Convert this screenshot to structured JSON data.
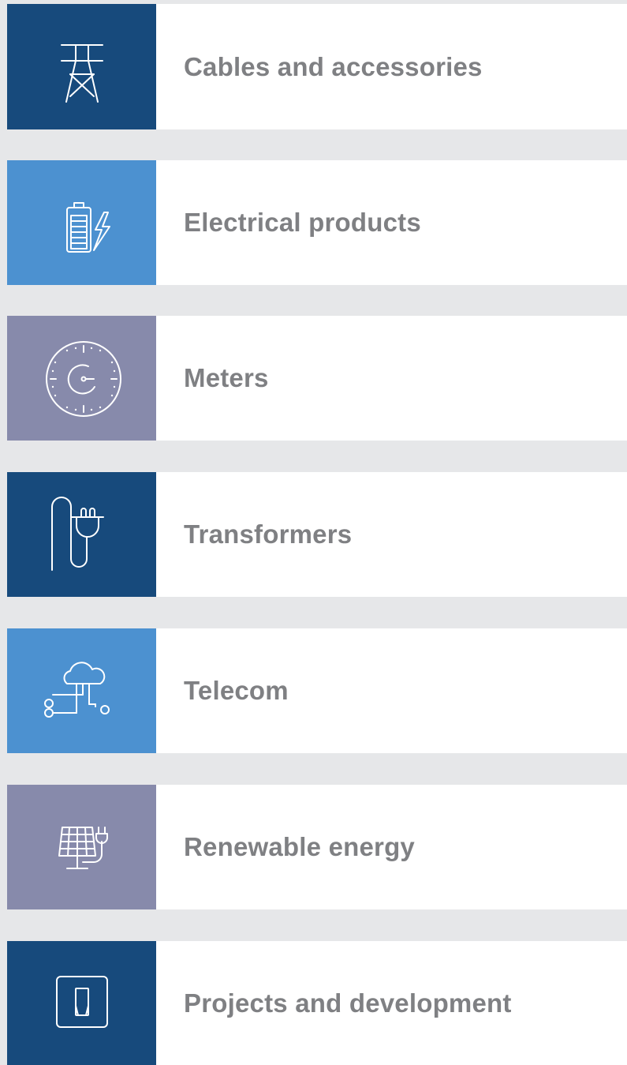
{
  "colors": {
    "page_background": "#e6e7e9",
    "card_background": "#ffffff",
    "label_text": "#7f8083",
    "tile_dark_blue": "#174a7c",
    "tile_light_blue": "#4c91d0",
    "tile_slate": "#878aab"
  },
  "categories": [
    {
      "label": "Cables and accessories",
      "icon": "transmission-tower-icon",
      "tile_color": "#174a7c"
    },
    {
      "label": "Electrical products",
      "icon": "battery-lightning-icon",
      "tile_color": "#4c91d0"
    },
    {
      "label": "Meters",
      "icon": "meter-dial-icon",
      "tile_color": "#878aab"
    },
    {
      "label": "Transformers",
      "icon": "plug-cable-icon",
      "tile_color": "#174a7c"
    },
    {
      "label": "Telecom",
      "icon": "cloud-network-icon",
      "tile_color": "#4c91d0"
    },
    {
      "label": "Renewable energy",
      "icon": "solar-panel-plug-icon",
      "tile_color": "#878aab"
    },
    {
      "label": "Projects and development",
      "icon": "wall-switch-icon",
      "tile_color": "#174a7c"
    }
  ]
}
